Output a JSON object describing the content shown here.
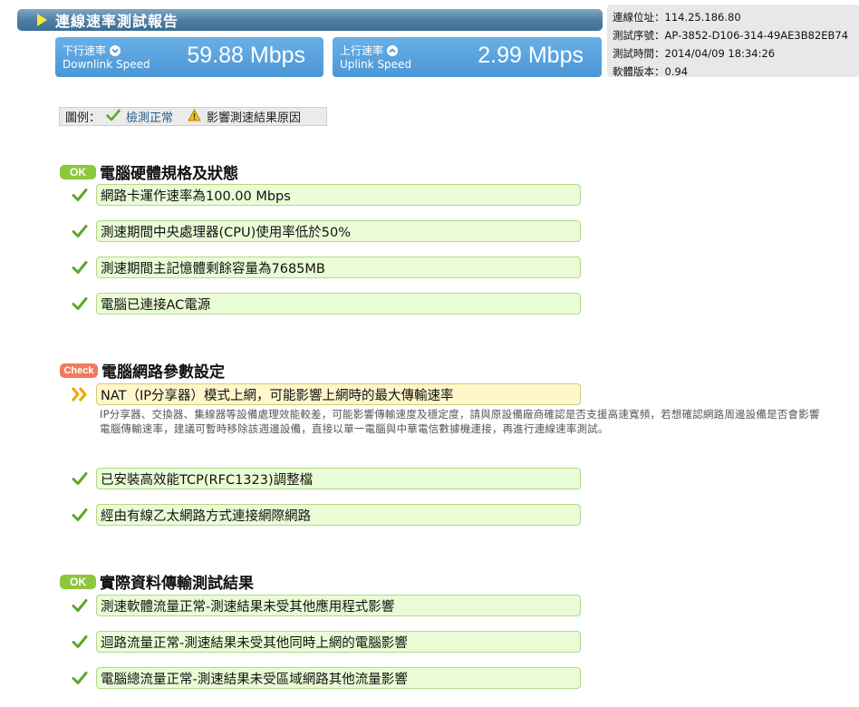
{
  "header": {
    "title": "連線速率測試報告"
  },
  "downlink": {
    "label_zh": "下行速率",
    "label_en": "Downlink Speed",
    "value": "59.88 Mbps"
  },
  "uplink": {
    "label_zh": "上行速率",
    "label_en": "Uplink Speed",
    "value": "2.99 Mbps"
  },
  "info": {
    "ip": "連線位址：114.25.186.80",
    "serial": "測試序號：AP-3852-D106-314-49AE3B82EB74",
    "time": "測試時間：2014/04/09 18:34:26",
    "version": "軟體版本：0.94"
  },
  "legend": {
    "prefix": "圖例：",
    "ok_label": "檢測正常",
    "warn_label": "影響測速結果原因"
  },
  "sections": [
    {
      "badge": "OK",
      "title": "電腦硬體規格及狀態",
      "items": [
        "網路卡運作速率為100.00 Mbps",
        "測速期間中央處理器(CPU)使用率低於50%",
        "測速期間主記憶體剩餘容量為7685MB",
        "電腦已連接AC電源"
      ]
    },
    {
      "badge": "Check",
      "title": "電腦網路參數設定",
      "warn_item": "NAT（IP分享器）模式上網，可能影響上網時的最大傳輸速率",
      "warn_note": "IP分享器、交換器、集線器等設備處理效能較差，可能影響傳輸速度及穩定度，請與原設備廠商確認是否支援高速寬頻，若想確認網路周邊設備是否會影響電腦傳輸速率，建議可暫時移除該週邊設備，直接以單一電腦與中華電信數據機連接，再進行連線速率測試。",
      "items": [
        "已安裝高效能TCP(RFC1323)調整檔",
        "經由有線乙太網路方式連接網際網路"
      ]
    },
    {
      "badge": "OK",
      "title": "實際資料傳輸測試結果",
      "items": [
        "測速軟體流量正常-測速結果未受其他應用程式影響",
        "迴路流量正常-測速結果未受其他同時上網的電腦影響",
        "電腦總流量正常-測速結果未受區域網路其他流量影響"
      ]
    }
  ],
  "colors": {
    "ok_green": "#8cc83c",
    "check_orange": "#ef7b5b",
    "speed_blue": "#4a96d6",
    "title_blue": "#4f7fa4"
  }
}
